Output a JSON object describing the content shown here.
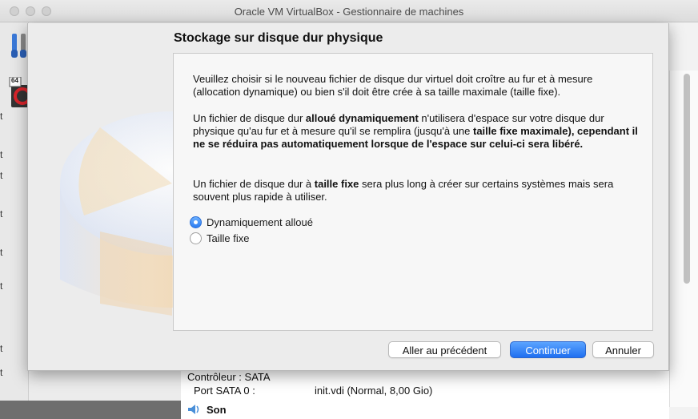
{
  "window": {
    "title": "Oracle VM VirtualBox - Gestionnaire de machines"
  },
  "sidebar": {
    "vm_badge": "64",
    "strip_letters": [
      "t",
      "t",
      "t",
      "t",
      "t",
      "t",
      "t",
      "t"
    ]
  },
  "details": {
    "controller_label": "Contrôleur : SATA",
    "port_label": "Port SATA 0 :",
    "port_value": "init.vdi (Normal, 8,00 Gio)",
    "audio_label": "Son"
  },
  "wizard": {
    "title": "Stockage sur disque dur physique",
    "para1": "Veuillez choisir si le nouveau fichier de disque dur virtuel doit croître au fur et à mesure (allocation dynamique) ou bien s'il doit être crée à sa taille maximale (taille fixe).",
    "para2": {
      "t1": "Un fichier de disque dur ",
      "b1": "alloué dynamiquement",
      "t2": " n'utilisera d'espace sur votre disque dur physique qu'au fur et à mesure qu'il se remplira (jusqu'à une ",
      "b2": "taille fixe maximale), cependant il ne se réduira pas automatiquement lorsque de l'espace sur celui-ci sera libéré."
    },
    "para3": {
      "t1": "Un fichier de disque dur à ",
      "b1": "taille fixe",
      "t2": " sera plus long à créer sur certains systèmes mais sera souvent plus rapide à utiliser."
    },
    "options": [
      {
        "label": "Dynamiquement alloué",
        "selected": true
      },
      {
        "label": "Taille fixe",
        "selected": false
      }
    ],
    "buttons": {
      "back": "Aller au précédent",
      "next": "Continuer",
      "cancel": "Annuler"
    }
  },
  "colors": {
    "accent": "#2b7cf2",
    "window_bg": "#ececec",
    "content_bg": "#f7f7f7"
  }
}
